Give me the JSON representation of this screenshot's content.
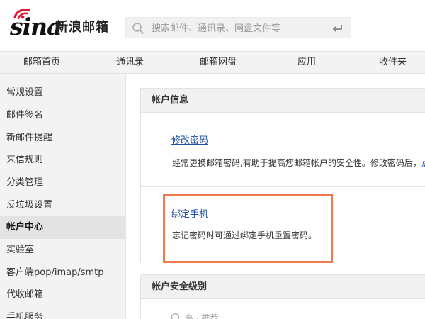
{
  "header": {
    "logo_wordmark": "sina",
    "logo_text": "新浪邮箱",
    "search_placeholder": "搜索邮件、通讯录、网盘文件等"
  },
  "nav": {
    "items": [
      "邮箱首页",
      "通讯录",
      "邮箱网盘",
      "应用",
      "收件夹"
    ]
  },
  "sidebar": {
    "items": [
      {
        "label": "常规设置"
      },
      {
        "label": "邮件签名"
      },
      {
        "label": "新邮件提醒"
      },
      {
        "label": "来信规则"
      },
      {
        "label": "分类管理"
      },
      {
        "label": "反垃圾设置"
      },
      {
        "label": "帐户中心",
        "active": true
      },
      {
        "label": "实验室"
      },
      {
        "label": "客户端pop/imap/smtp"
      },
      {
        "label": "代收邮箱"
      },
      {
        "label": "手机服务"
      }
    ]
  },
  "account_info": {
    "title": "帐户信息",
    "change_password": {
      "link": "修改密码",
      "description": "经常更换邮箱密码,有助于提高您邮箱帐户的安全性。修改密码后，",
      "description_link": "点"
    },
    "bind_phone": {
      "link": "绑定手机",
      "description": "忘记密码时可通过绑定手机重置密码。"
    }
  },
  "security_level": {
    "title": "帐户安全级别",
    "option_label": "高 · 推荐"
  },
  "colors": {
    "highlight_border": "#ee7a4d",
    "link": "#1f4fa6",
    "sidebar_bg": "#f3f3f3"
  }
}
